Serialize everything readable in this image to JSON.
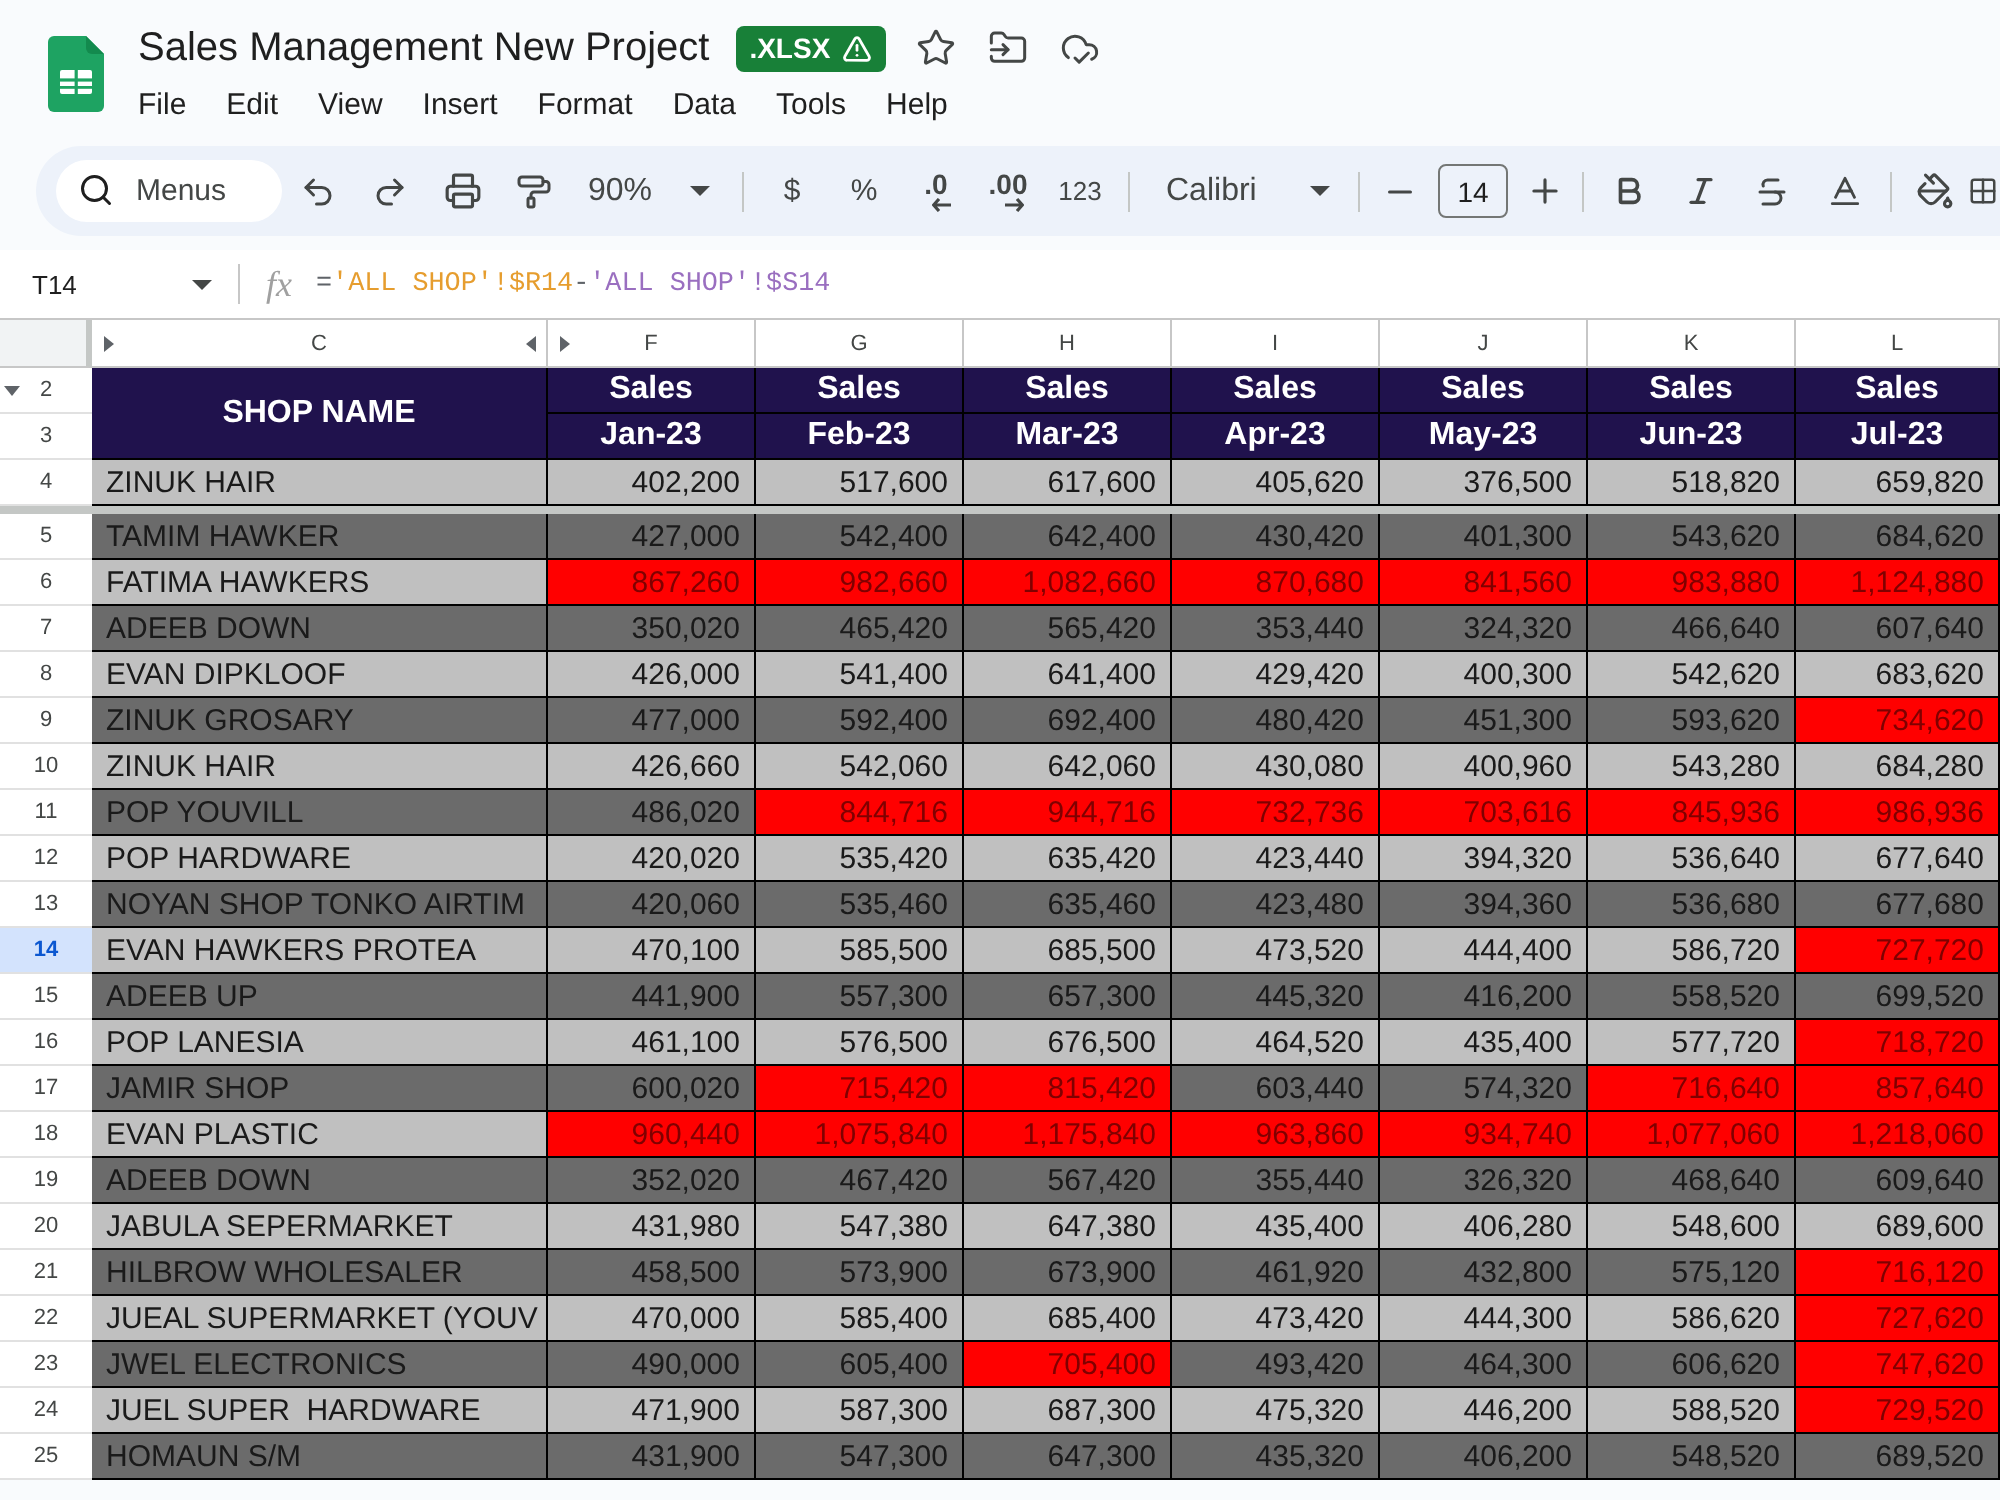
{
  "document": {
    "title": "Sales Management New Project",
    "file_format": ".XLSX"
  },
  "menu": [
    "File",
    "Edit",
    "View",
    "Insert",
    "Format",
    "Data",
    "Tools",
    "Help"
  ],
  "toolbar": {
    "search_placeholder": "Menus",
    "zoom": "90%",
    "currency": "$",
    "percent": "%",
    "decrease_decimal": ".0",
    "increase_decimal": ".00",
    "number_format": "123",
    "font": "Calibri",
    "font_size": "14"
  },
  "formula_bar": {
    "cell_reference": "T14",
    "function_symbol": "fx",
    "formula": [
      {
        "text": "=",
        "color": "#5f6368"
      },
      {
        "text": "'ALL SHOP'!$R14",
        "color": "#e69d2e"
      },
      {
        "text": "-",
        "color": "#5f6368"
      },
      {
        "text": "'ALL SHOP'!$S14",
        "color": "#9a6fc0"
      }
    ]
  },
  "sheet": {
    "columns": [
      {
        "label": "C",
        "hidden_before": true,
        "hidden_after": true
      },
      {
        "label": "F",
        "hidden_before": true,
        "hidden_after": false
      },
      {
        "label": "G",
        "hidden_before": false,
        "hidden_after": false
      },
      {
        "label": "H",
        "hidden_before": false,
        "hidden_after": false
      },
      {
        "label": "I",
        "hidden_before": false,
        "hidden_after": false
      },
      {
        "label": "J",
        "hidden_before": false,
        "hidden_after": false
      },
      {
        "label": "K",
        "hidden_before": false,
        "hidden_after": false
      },
      {
        "label": "L",
        "hidden_before": false,
        "hidden_after": false
      }
    ],
    "header_rows": [
      {
        "label": "2",
        "hidden_before": true
      },
      {
        "label": "3",
        "hidden_before": false
      }
    ],
    "shop_heading": "SHOP NAME",
    "month_headings": [
      {
        "label": "Sales",
        "period": "Jan-23"
      },
      {
        "label": "Sales",
        "period": "Feb-23"
      },
      {
        "label": "Sales",
        "period": "Mar-23"
      },
      {
        "label": "Sales",
        "period": "Apr-23"
      },
      {
        "label": "Sales",
        "period": "May-23"
      },
      {
        "label": "Sales",
        "period": "Jun-23"
      },
      {
        "label": "Sales",
        "period": "Jul-23"
      }
    ],
    "frozen_rows": [
      {
        "number": "4",
        "selected": false,
        "kind": "light",
        "shop": "ZINUK HAIR",
        "values": [
          {
            "text": "402,200",
            "flagged": false
          },
          {
            "text": "517,600",
            "flagged": false
          },
          {
            "text": "617,600",
            "flagged": false
          },
          {
            "text": "405,620",
            "flagged": false
          },
          {
            "text": "376,500",
            "flagged": false
          },
          {
            "text": "518,820",
            "flagged": false
          },
          {
            "text": "659,820",
            "flagged": false
          }
        ]
      }
    ],
    "rows": [
      {
        "number": "5",
        "selected": false,
        "kind": "dark",
        "shop": "TAMIM HAWKER",
        "values": [
          {
            "text": "427,000",
            "flagged": false
          },
          {
            "text": "542,400",
            "flagged": false
          },
          {
            "text": "642,400",
            "flagged": false
          },
          {
            "text": "430,420",
            "flagged": false
          },
          {
            "text": "401,300",
            "flagged": false
          },
          {
            "text": "543,620",
            "flagged": false
          },
          {
            "text": "684,620",
            "flagged": false
          }
        ]
      },
      {
        "number": "6",
        "selected": false,
        "kind": "light",
        "shop": "FATIMA HAWKERS",
        "values": [
          {
            "text": "867,260",
            "flagged": true
          },
          {
            "text": "982,660",
            "flagged": true
          },
          {
            "text": "1,082,660",
            "flagged": true
          },
          {
            "text": "870,680",
            "flagged": true
          },
          {
            "text": "841,560",
            "flagged": true
          },
          {
            "text": "983,880",
            "flagged": true
          },
          {
            "text": "1,124,880",
            "flagged": true
          }
        ]
      },
      {
        "number": "7",
        "selected": false,
        "kind": "dark",
        "shop": "ADEEB DOWN",
        "values": [
          {
            "text": "350,020",
            "flagged": false
          },
          {
            "text": "465,420",
            "flagged": false
          },
          {
            "text": "565,420",
            "flagged": false
          },
          {
            "text": "353,440",
            "flagged": false
          },
          {
            "text": "324,320",
            "flagged": false
          },
          {
            "text": "466,640",
            "flagged": false
          },
          {
            "text": "607,640",
            "flagged": false
          }
        ]
      },
      {
        "number": "8",
        "selected": false,
        "kind": "light",
        "shop": "EVAN DIPKLOOF",
        "values": [
          {
            "text": "426,000",
            "flagged": false
          },
          {
            "text": "541,400",
            "flagged": false
          },
          {
            "text": "641,400",
            "flagged": false
          },
          {
            "text": "429,420",
            "flagged": false
          },
          {
            "text": "400,300",
            "flagged": false
          },
          {
            "text": "542,620",
            "flagged": false
          },
          {
            "text": "683,620",
            "flagged": false
          }
        ]
      },
      {
        "number": "9",
        "selected": false,
        "kind": "dark",
        "shop": "ZINUK GROSARY",
        "values": [
          {
            "text": "477,000",
            "flagged": false
          },
          {
            "text": "592,400",
            "flagged": false
          },
          {
            "text": "692,400",
            "flagged": false
          },
          {
            "text": "480,420",
            "flagged": false
          },
          {
            "text": "451,300",
            "flagged": false
          },
          {
            "text": "593,620",
            "flagged": false
          },
          {
            "text": "734,620",
            "flagged": true
          }
        ]
      },
      {
        "number": "10",
        "selected": false,
        "kind": "light",
        "shop": "ZINUK HAIR",
        "values": [
          {
            "text": "426,660",
            "flagged": false
          },
          {
            "text": "542,060",
            "flagged": false
          },
          {
            "text": "642,060",
            "flagged": false
          },
          {
            "text": "430,080",
            "flagged": false
          },
          {
            "text": "400,960",
            "flagged": false
          },
          {
            "text": "543,280",
            "flagged": false
          },
          {
            "text": "684,280",
            "flagged": false
          }
        ]
      },
      {
        "number": "11",
        "selected": false,
        "kind": "dark",
        "shop": "POP YOUVILL",
        "values": [
          {
            "text": "486,020",
            "flagged": false
          },
          {
            "text": "844,716",
            "flagged": true
          },
          {
            "text": "944,716",
            "flagged": true
          },
          {
            "text": "732,736",
            "flagged": true
          },
          {
            "text": "703,616",
            "flagged": true
          },
          {
            "text": "845,936",
            "flagged": true
          },
          {
            "text": "986,936",
            "flagged": true
          }
        ]
      },
      {
        "number": "12",
        "selected": false,
        "kind": "light",
        "shop": "POP HARDWARE",
        "values": [
          {
            "text": "420,020",
            "flagged": false
          },
          {
            "text": "535,420",
            "flagged": false
          },
          {
            "text": "635,420",
            "flagged": false
          },
          {
            "text": "423,440",
            "flagged": false
          },
          {
            "text": "394,320",
            "flagged": false
          },
          {
            "text": "536,640",
            "flagged": false
          },
          {
            "text": "677,640",
            "flagged": false
          }
        ]
      },
      {
        "number": "13",
        "selected": false,
        "kind": "dark",
        "shop": "NOYAN SHOP TONKO AIRTIM",
        "values": [
          {
            "text": "420,060",
            "flagged": false
          },
          {
            "text": "535,460",
            "flagged": false
          },
          {
            "text": "635,460",
            "flagged": false
          },
          {
            "text": "423,480",
            "flagged": false
          },
          {
            "text": "394,360",
            "flagged": false
          },
          {
            "text": "536,680",
            "flagged": false
          },
          {
            "text": "677,680",
            "flagged": false
          }
        ]
      },
      {
        "number": "14",
        "selected": true,
        "kind": "light",
        "shop": "EVAN HAWKERS PROTEA",
        "values": [
          {
            "text": "470,100",
            "flagged": false
          },
          {
            "text": "585,500",
            "flagged": false
          },
          {
            "text": "685,500",
            "flagged": false
          },
          {
            "text": "473,520",
            "flagged": false
          },
          {
            "text": "444,400",
            "flagged": false
          },
          {
            "text": "586,720",
            "flagged": false
          },
          {
            "text": "727,720",
            "flagged": true
          }
        ]
      },
      {
        "number": "15",
        "selected": false,
        "kind": "dark",
        "shop": "ADEEB UP",
        "values": [
          {
            "text": "441,900",
            "flagged": false
          },
          {
            "text": "557,300",
            "flagged": false
          },
          {
            "text": "657,300",
            "flagged": false
          },
          {
            "text": "445,320",
            "flagged": false
          },
          {
            "text": "416,200",
            "flagged": false
          },
          {
            "text": "558,520",
            "flagged": false
          },
          {
            "text": "699,520",
            "flagged": false
          }
        ]
      },
      {
        "number": "16",
        "selected": false,
        "kind": "light",
        "shop": "POP LANESIA",
        "values": [
          {
            "text": "461,100",
            "flagged": false
          },
          {
            "text": "576,500",
            "flagged": false
          },
          {
            "text": "676,500",
            "flagged": false
          },
          {
            "text": "464,520",
            "flagged": false
          },
          {
            "text": "435,400",
            "flagged": false
          },
          {
            "text": "577,720",
            "flagged": false
          },
          {
            "text": "718,720",
            "flagged": true
          }
        ]
      },
      {
        "number": "17",
        "selected": false,
        "kind": "dark",
        "shop": "JAMIR SHOP",
        "values": [
          {
            "text": "600,020",
            "flagged": false
          },
          {
            "text": "715,420",
            "flagged": true
          },
          {
            "text": "815,420",
            "flagged": true
          },
          {
            "text": "603,440",
            "flagged": false
          },
          {
            "text": "574,320",
            "flagged": false
          },
          {
            "text": "716,640",
            "flagged": true
          },
          {
            "text": "857,640",
            "flagged": true
          }
        ]
      },
      {
        "number": "18",
        "selected": false,
        "kind": "light",
        "shop": "EVAN PLASTIC",
        "values": [
          {
            "text": "960,440",
            "flagged": true
          },
          {
            "text": "1,075,840",
            "flagged": true
          },
          {
            "text": "1,175,840",
            "flagged": true
          },
          {
            "text": "963,860",
            "flagged": true
          },
          {
            "text": "934,740",
            "flagged": true
          },
          {
            "text": "1,077,060",
            "flagged": true
          },
          {
            "text": "1,218,060",
            "flagged": true
          }
        ]
      },
      {
        "number": "19",
        "selected": false,
        "kind": "dark",
        "shop": "ADEEB DOWN",
        "values": [
          {
            "text": "352,020",
            "flagged": false
          },
          {
            "text": "467,420",
            "flagged": false
          },
          {
            "text": "567,420",
            "flagged": false
          },
          {
            "text": "355,440",
            "flagged": false
          },
          {
            "text": "326,320",
            "flagged": false
          },
          {
            "text": "468,640",
            "flagged": false
          },
          {
            "text": "609,640",
            "flagged": false
          }
        ]
      },
      {
        "number": "20",
        "selected": false,
        "kind": "light",
        "shop": "JABULA SEPERMARKET",
        "values": [
          {
            "text": "431,980",
            "flagged": false
          },
          {
            "text": "547,380",
            "flagged": false
          },
          {
            "text": "647,380",
            "flagged": false
          },
          {
            "text": "435,400",
            "flagged": false
          },
          {
            "text": "406,280",
            "flagged": false
          },
          {
            "text": "548,600",
            "flagged": false
          },
          {
            "text": "689,600",
            "flagged": false
          }
        ]
      },
      {
        "number": "21",
        "selected": false,
        "kind": "dark",
        "shop": "HILBROW WHOLESALER",
        "values": [
          {
            "text": "458,500",
            "flagged": false
          },
          {
            "text": "573,900",
            "flagged": false
          },
          {
            "text": "673,900",
            "flagged": false
          },
          {
            "text": "461,920",
            "flagged": false
          },
          {
            "text": "432,800",
            "flagged": false
          },
          {
            "text": "575,120",
            "flagged": false
          },
          {
            "text": "716,120",
            "flagged": true
          }
        ]
      },
      {
        "number": "22",
        "selected": false,
        "kind": "light",
        "shop": "JUEAL SUPERMARKET (YOUV",
        "values": [
          {
            "text": "470,000",
            "flagged": false
          },
          {
            "text": "585,400",
            "flagged": false
          },
          {
            "text": "685,400",
            "flagged": false
          },
          {
            "text": "473,420",
            "flagged": false
          },
          {
            "text": "444,300",
            "flagged": false
          },
          {
            "text": "586,620",
            "flagged": false
          },
          {
            "text": "727,620",
            "flagged": true
          }
        ]
      },
      {
        "number": "23",
        "selected": false,
        "kind": "dark",
        "shop": "JWEL ELECTRONICS",
        "values": [
          {
            "text": "490,000",
            "flagged": false
          },
          {
            "text": "605,400",
            "flagged": false
          },
          {
            "text": "705,400",
            "flagged": true
          },
          {
            "text": "493,420",
            "flagged": false
          },
          {
            "text": "464,300",
            "flagged": false
          },
          {
            "text": "606,620",
            "flagged": false
          },
          {
            "text": "747,620",
            "flagged": true
          }
        ]
      },
      {
        "number": "24",
        "selected": false,
        "kind": "light",
        "shop": "JUEL SUPER  HARDWARE",
        "values": [
          {
            "text": "471,900",
            "flagged": false
          },
          {
            "text": "587,300",
            "flagged": false
          },
          {
            "text": "687,300",
            "flagged": false
          },
          {
            "text": "475,320",
            "flagged": false
          },
          {
            "text": "446,200",
            "flagged": false
          },
          {
            "text": "588,520",
            "flagged": false
          },
          {
            "text": "729,520",
            "flagged": true
          }
        ]
      },
      {
        "number": "25",
        "selected": false,
        "kind": "dark",
        "shop": "HOMAUN S/M",
        "values": [
          {
            "text": "431,900",
            "flagged": false
          },
          {
            "text": "547,300",
            "flagged": false
          },
          {
            "text": "647,300",
            "flagged": false
          },
          {
            "text": "435,320",
            "flagged": false
          },
          {
            "text": "406,200",
            "flagged": false
          },
          {
            "text": "548,520",
            "flagged": false
          },
          {
            "text": "689,520",
            "flagged": false
          }
        ]
      }
    ]
  }
}
